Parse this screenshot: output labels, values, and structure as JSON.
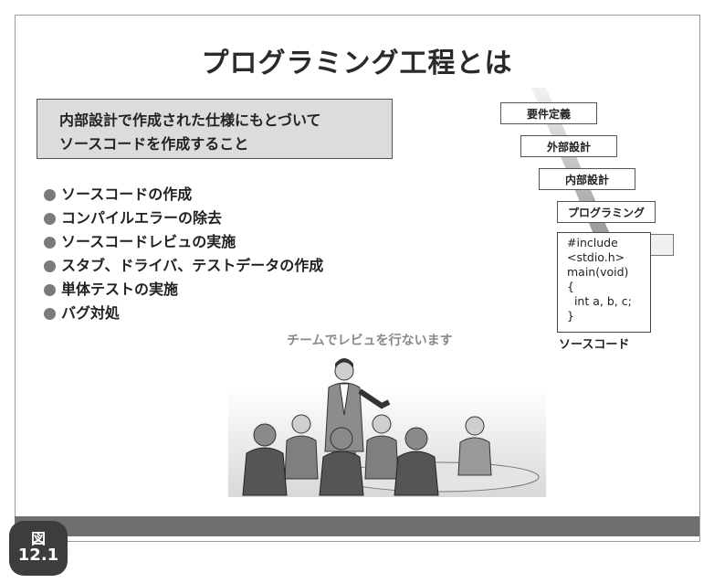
{
  "title": "プログラミング工程とは",
  "definition": {
    "line1": "内部設計で作成された仕様にもとづいて",
    "line2": "ソースコードを作成すること"
  },
  "bullets": [
    "ソースコードの作成",
    "コンパイルエラーの除去",
    "ソースコードレビュの実施",
    "スタブ、ドライバ、テストデータの作成",
    "単体テストの実施",
    "バグ対処"
  ],
  "process_steps": [
    "要件定義",
    "外部設計",
    "内部設計",
    "プログラミング"
  ],
  "source_code": {
    "lines": [
      "#include",
      "<stdio.h>",
      "main(void)",
      "{",
      "  int a, b, c;",
      "}"
    ],
    "caption": "ソースコード"
  },
  "meeting_caption": "チームでレビュを行ないます",
  "figure": {
    "label": "図",
    "number": "12.1"
  },
  "colors": {
    "bar": "#6f6f6f",
    "badge": "#3d3d3d",
    "box_fill": "#dcdcdc",
    "bullet_dot": "#7a7a7a"
  }
}
